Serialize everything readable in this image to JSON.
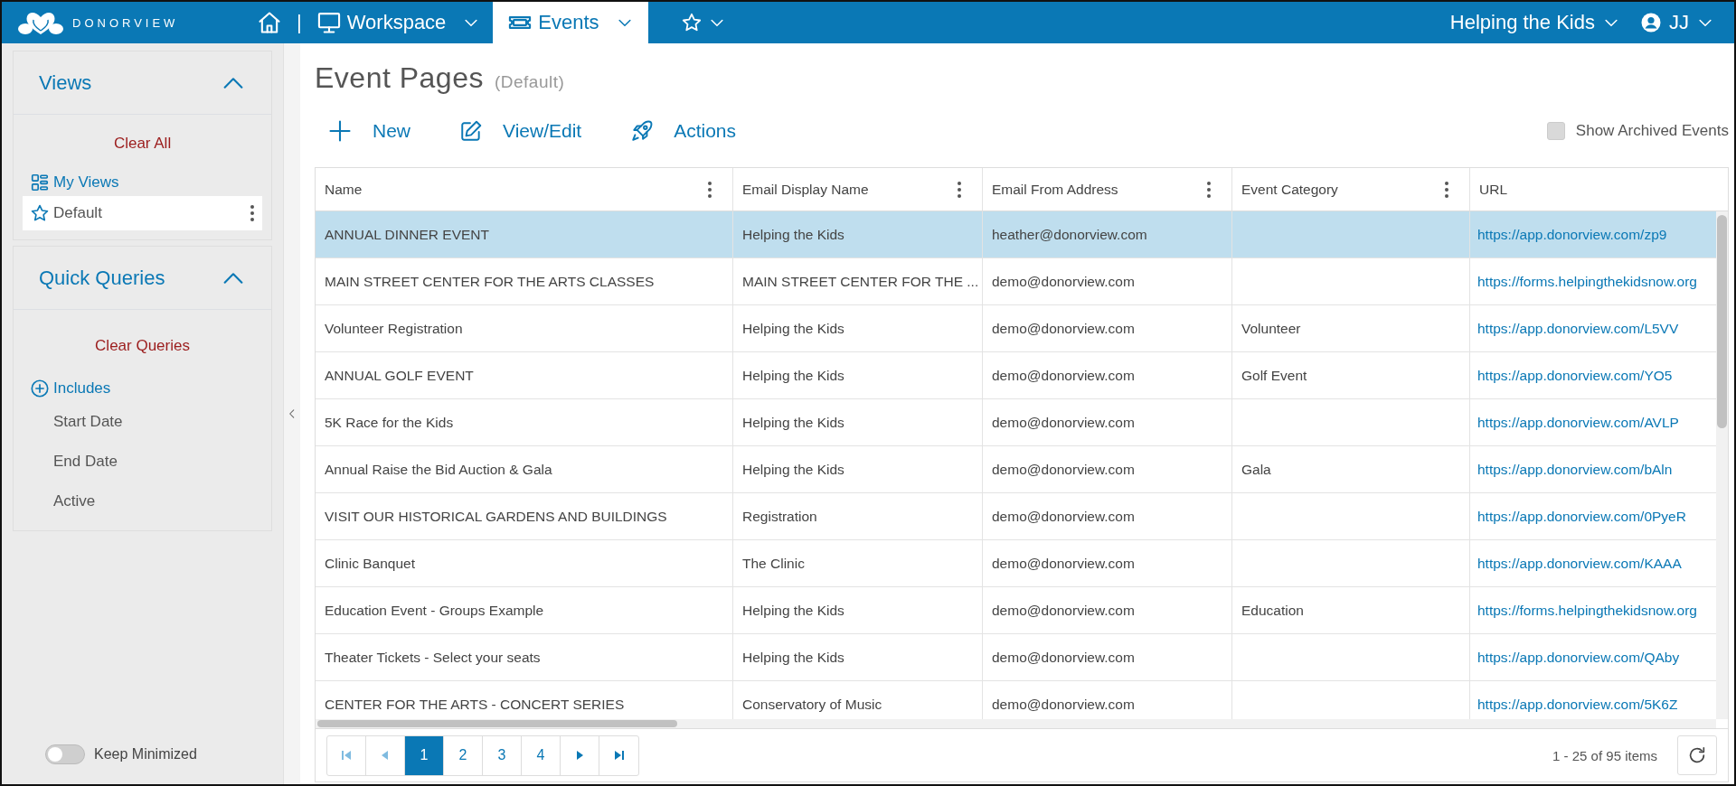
{
  "header": {
    "logo": "DONORVIEW",
    "separator": "|",
    "nav": [
      {
        "kind": "home",
        "selected": false
      },
      {
        "kind": "workspace",
        "label": "Workspace",
        "selected": false
      },
      {
        "kind": "events",
        "label": "Events",
        "selected": true
      },
      {
        "kind": "favorites",
        "selected": false
      }
    ],
    "organization": "Helping the Kids",
    "user": "JJ"
  },
  "sidebar": {
    "views": {
      "title": "Views",
      "expanded": true,
      "clear": "Clear All",
      "my_views": "My Views",
      "items": [
        {
          "label": "Default",
          "selected": true
        }
      ]
    },
    "quick_queries": {
      "title": "Quick Queries",
      "expanded": true,
      "clear": "Clear Queries",
      "includes": "Includes",
      "items": [
        "Start Date",
        "End Date",
        "Active"
      ]
    },
    "keep_minimized": {
      "label": "Keep Minimized",
      "on": false
    }
  },
  "page": {
    "title": "Event Pages",
    "subtitle": "(Default)",
    "actions": [
      {
        "kind": "new",
        "label": "New"
      },
      {
        "kind": "edit",
        "label": "View/Edit"
      },
      {
        "kind": "actions",
        "label": "Actions"
      }
    ],
    "show_archived": {
      "label": "Show Archived Events",
      "checked": false
    }
  },
  "table": {
    "columns": [
      {
        "label": "Name",
        "menu": true
      },
      {
        "label": "Email Display Name",
        "menu": true
      },
      {
        "label": "Email From Address",
        "menu": true
      },
      {
        "label": "Event Category",
        "menu": true
      },
      {
        "label": "URL",
        "menu": false
      }
    ],
    "rows": [
      {
        "selected": true,
        "name": "ANNUAL DINNER EVENT",
        "display_name": "Helping the Kids",
        "from": "heather@donorview.com",
        "url": "https://app.donorview.com/zp9"
      },
      {
        "selected": false,
        "name": "MAIN STREET CENTER FOR THE ARTS CLASSES",
        "display_name": "MAIN STREET CENTER FOR THE ...",
        "from": "demo@donorview.com",
        "url": "https://forms.helpingthekidsnow.org"
      },
      {
        "selected": false,
        "name": "Volunteer Registration",
        "display_name": "Helping the Kids",
        "from": "demo@donorview.com",
        "category": "Volunteer",
        "url": "https://app.donorview.com/L5VV"
      },
      {
        "selected": false,
        "name": "ANNUAL GOLF EVENT",
        "display_name": "Helping the Kids",
        "from": "demo@donorview.com",
        "category": "Golf Event",
        "url": "https://app.donorview.com/YO5"
      },
      {
        "selected": false,
        "name": "5K Race for the Kids",
        "display_name": "Helping the Kids",
        "from": "demo@donorview.com",
        "url": "https://app.donorview.com/AVLP"
      },
      {
        "selected": false,
        "name": "Annual Raise the Bid Auction & Gala",
        "display_name": "Helping the Kids",
        "from": "demo@donorview.com",
        "category": "Gala",
        "url": "https://app.donorview.com/bAln"
      },
      {
        "selected": false,
        "name": "VISIT OUR HISTORICAL GARDENS AND BUILDINGS",
        "display_name": "Registration",
        "from": "demo@donorview.com",
        "url": "https://app.donorview.com/0PyeR"
      },
      {
        "selected": false,
        "name": "Clinic Banquet",
        "display_name": "The Clinic",
        "from": "demo@donorview.com",
        "url": "https://app.donorview.com/KAAA"
      },
      {
        "selected": false,
        "name": "Education Event - Groups Example",
        "display_name": "Helping the Kids",
        "from": "demo@donorview.com",
        "category": "Education",
        "url": "https://forms.helpingthekidsnow.org"
      },
      {
        "selected": false,
        "name": "Theater Tickets - Select your seats",
        "display_name": "Helping the Kids",
        "from": "demo@donorview.com",
        "url": "https://app.donorview.com/QAby"
      },
      {
        "selected": false,
        "name": "CENTER FOR THE ARTS - CONCERT SERIES",
        "display_name": "Conservatory of Music",
        "from": "demo@donorview.com",
        "url": "https://app.donorview.com/5K6Z"
      }
    ]
  },
  "pager": {
    "pages": [
      {
        "label": "1",
        "selected": true
      },
      {
        "label": "2",
        "selected": false
      },
      {
        "label": "3",
        "selected": false
      },
      {
        "label": "4",
        "selected": false
      }
    ],
    "summary": "1 - 25 of 95 items"
  }
}
